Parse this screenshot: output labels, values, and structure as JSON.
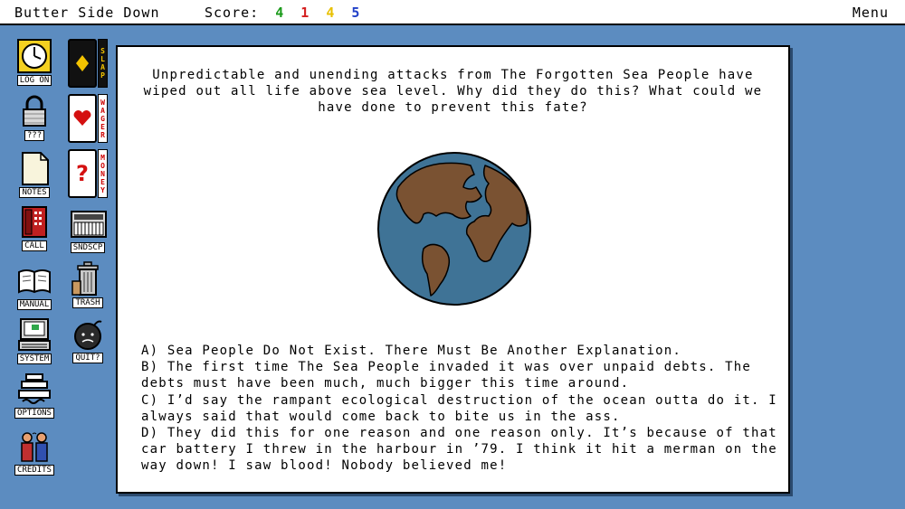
{
  "header": {
    "title": "Butter Side Down",
    "score_label": "Score:",
    "scores": [
      {
        "value": "4",
        "color": "#1a9a1a"
      },
      {
        "value": "1",
        "color": "#d42020"
      },
      {
        "value": "4",
        "color": "#e8c000"
      },
      {
        "value": "5",
        "color": "#2040c8"
      }
    ],
    "menu_label": "Menu"
  },
  "desktop": {
    "logon": "LOG ON",
    "locked": "???",
    "notes": "NOTES",
    "call": "CALL",
    "manual": "MANUAL",
    "system": "SYSTEM",
    "options": "OPTIONS",
    "credits": "CREDITS",
    "sndscp": "SNDSCP",
    "trash": "TRASH",
    "quit": "QUIT?"
  },
  "cards": {
    "slap": [
      "S",
      "L",
      "A",
      "P"
    ],
    "wager": [
      "W",
      "A",
      "G",
      "E",
      "R"
    ],
    "money": [
      "M",
      "O",
      "N",
      "E",
      "Y"
    ],
    "mystery_glyph": "?"
  },
  "question": "Unpredictable and unending attacks from The Forgotten Sea People have wiped out all life above sea level. Why did they do this? What could we have done to prevent this fate?",
  "answers": [
    "A) Sea People Do Not Exist. There Must Be Another Explanation.",
    "B) The first time The Sea People invaded it was over unpaid debts. The debts must have been much, much bigger this time around.",
    "C) I’d say the rampant ecological destruction of the ocean outta do it. I always said that would come back to bite us in the ass.",
    "D) They did this for one reason and one reason only. It’s because of that car battery I threw in the harbour in ’79. I think it hit a merman on the way down! I saw blood! Nobody believed me!"
  ],
  "colors": {
    "ocean": "#3f7396",
    "land": "#7a5232",
    "desktop": "#5c8cc0"
  }
}
